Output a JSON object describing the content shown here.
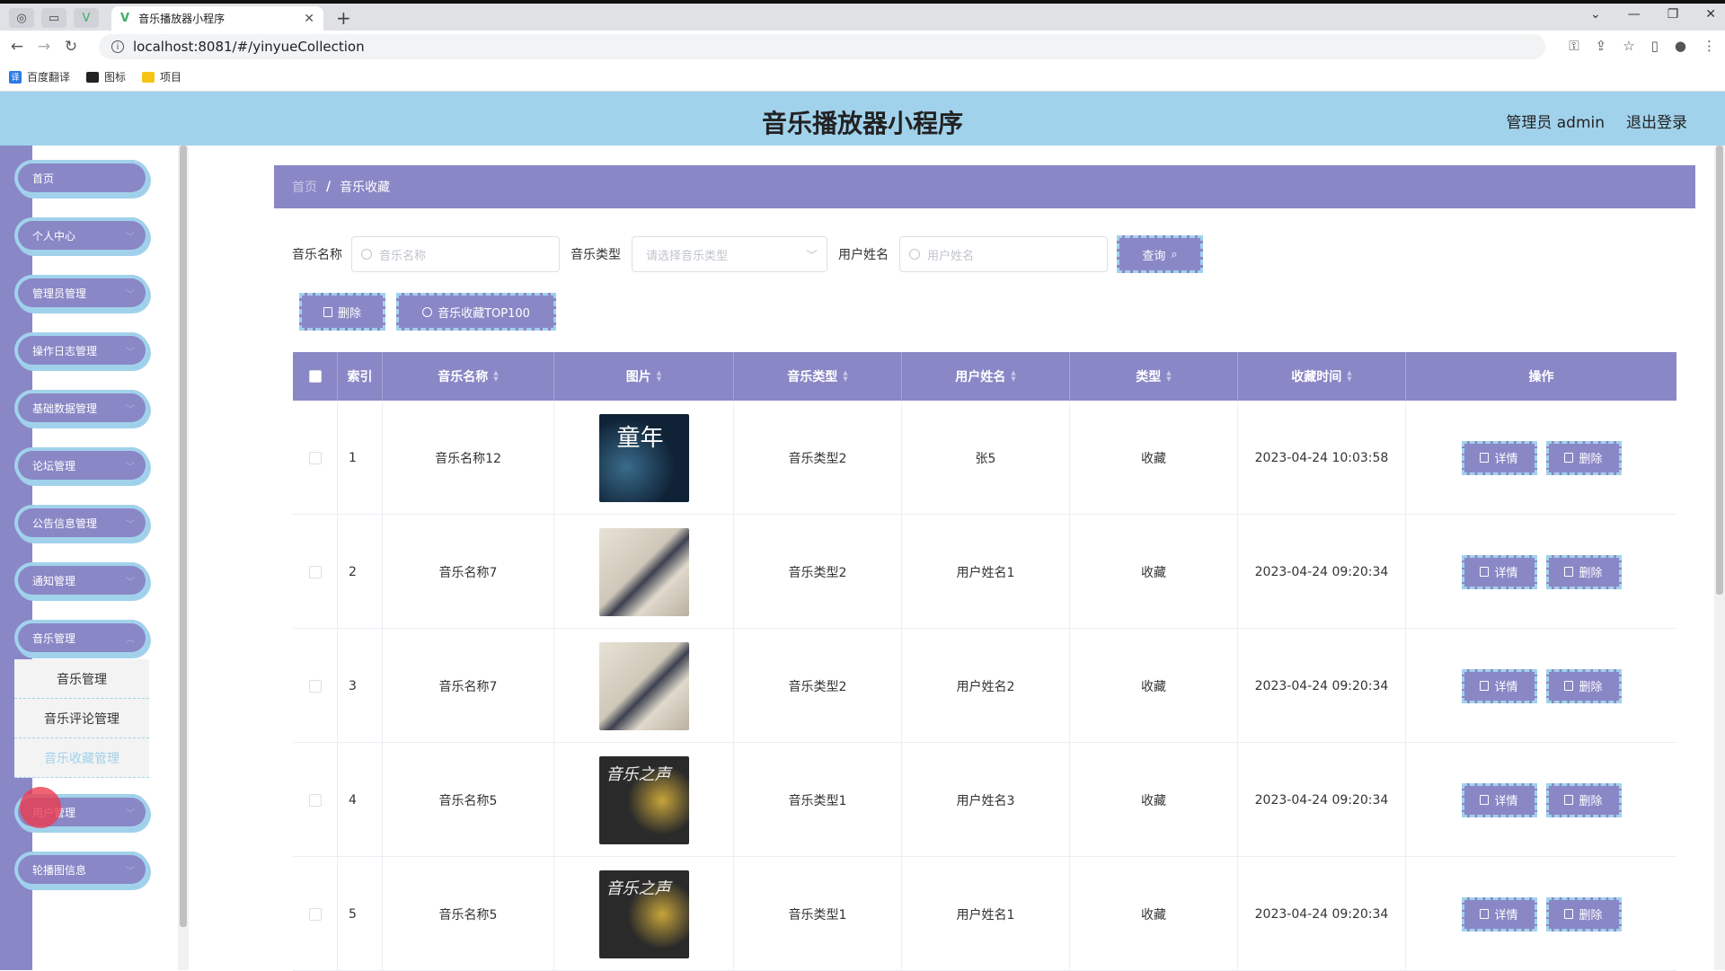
{
  "browser": {
    "tab_title": "音乐播放器小程序",
    "url": "localhost:8081/#/yinyueCollection",
    "bookmarks": [
      "百度翻译",
      "图标",
      "项目"
    ]
  },
  "header": {
    "title": "音乐播放器小程序",
    "user_label": "管理员 admin",
    "logout": "退出登录"
  },
  "sidebar": {
    "items": [
      "首页",
      "个人中心",
      "管理员管理",
      "操作日志管理",
      "基础数据管理",
      "论坛管理",
      "公告信息管理",
      "通知管理",
      "音乐管理"
    ],
    "submenu": [
      "音乐管理",
      "音乐评论管理",
      "音乐收藏管理"
    ],
    "items_after": [
      "用户管理",
      "轮播图信息"
    ]
  },
  "breadcrumb": {
    "home": "首页",
    "current": "音乐收藏"
  },
  "search": {
    "music_name_label": "音乐名称",
    "music_name_placeholder": "音乐名称",
    "music_type_label": "音乐类型",
    "music_type_placeholder": "请选择音乐类型",
    "user_name_label": "用户姓名",
    "user_name_placeholder": "用户姓名",
    "query_button": "查询"
  },
  "actions": {
    "delete": "删除",
    "top100": "音乐收藏TOP100"
  },
  "table": {
    "columns": [
      "索引",
      "音乐名称",
      "图片",
      "音乐类型",
      "用户姓名",
      "类型",
      "收藏时间",
      "操作"
    ],
    "row_detail": "详情",
    "row_delete": "删除",
    "rows": [
      {
        "index": "1",
        "name": "音乐名称12",
        "image": "童年",
        "type": "音乐类型2",
        "user": "张5",
        "kind": "收藏",
        "time": "2023-04-24 10:03:58"
      },
      {
        "index": "2",
        "name": "音乐名称7",
        "image": "",
        "type": "音乐类型2",
        "user": "用户姓名1",
        "kind": "收藏",
        "time": "2023-04-24 09:20:34"
      },
      {
        "index": "3",
        "name": "音乐名称7",
        "image": "",
        "type": "音乐类型2",
        "user": "用户姓名2",
        "kind": "收藏",
        "time": "2023-04-24 09:20:34"
      },
      {
        "index": "4",
        "name": "音乐名称5",
        "image": "音乐之声",
        "type": "音乐类型1",
        "user": "用户姓名3",
        "kind": "收藏",
        "time": "2023-04-24 09:20:34"
      },
      {
        "index": "5",
        "name": "音乐名称5",
        "image": "音乐之声",
        "type": "音乐类型1",
        "user": "用户姓名1",
        "kind": "收藏",
        "time": "2023-04-24 09:20:34"
      }
    ]
  },
  "colors": {
    "primary": "#8a87c6",
    "accent": "#a1d2ec"
  }
}
